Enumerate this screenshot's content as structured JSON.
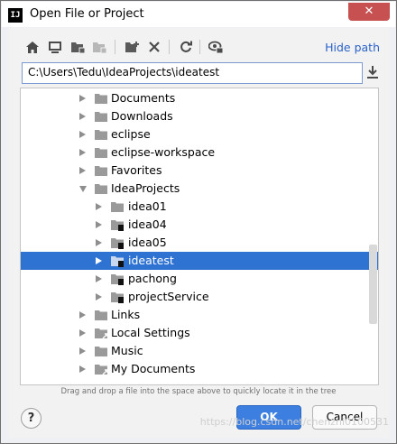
{
  "window": {
    "title": "Open File or Project",
    "logo": "IJ",
    "close": "✕"
  },
  "toolbar": {
    "icons": [
      "home-icon",
      "desktop-icon",
      "project-folder-icon",
      "module-folder-icon",
      "new-folder-icon",
      "delete-icon",
      "refresh-icon",
      "show-hidden-icon"
    ],
    "hide_path_label": "Hide path"
  },
  "path_field": {
    "value": "C:\\Users\\Tedu\\IdeaProjects\\ideatest"
  },
  "tree": {
    "items": [
      {
        "label": "Documents",
        "level": 0,
        "expanded": false,
        "icon": "folder-icon",
        "selected": false
      },
      {
        "label": "Downloads",
        "level": 0,
        "expanded": false,
        "icon": "folder-icon",
        "selected": false
      },
      {
        "label": "eclipse",
        "level": 0,
        "expanded": false,
        "icon": "folder-icon",
        "selected": false
      },
      {
        "label": "eclipse-workspace",
        "level": 0,
        "expanded": false,
        "icon": "folder-icon",
        "selected": false
      },
      {
        "label": "Favorites",
        "level": 0,
        "expanded": false,
        "icon": "folder-icon",
        "selected": false
      },
      {
        "label": "IdeaProjects",
        "level": 0,
        "expanded": true,
        "icon": "folder-icon",
        "selected": false
      },
      {
        "label": "idea01",
        "level": 1,
        "expanded": false,
        "icon": "folder-icon",
        "selected": false
      },
      {
        "label": "idea04",
        "level": 1,
        "expanded": false,
        "icon": "project-folder-icon",
        "selected": false
      },
      {
        "label": "idea05",
        "level": 1,
        "expanded": false,
        "icon": "project-folder-icon",
        "selected": false
      },
      {
        "label": "ideatest",
        "level": 1,
        "expanded": false,
        "icon": "project-folder-icon",
        "selected": true
      },
      {
        "label": "pachong",
        "level": 1,
        "expanded": false,
        "icon": "project-folder-icon",
        "selected": false
      },
      {
        "label": "projectService",
        "level": 1,
        "expanded": false,
        "icon": "project-folder-icon",
        "selected": false
      },
      {
        "label": "Links",
        "level": 0,
        "expanded": false,
        "icon": "folder-icon",
        "selected": false
      },
      {
        "label": "Local Settings",
        "level": 0,
        "expanded": false,
        "icon": "shortcut-folder-icon",
        "selected": false
      },
      {
        "label": "Music",
        "level": 0,
        "expanded": false,
        "icon": "folder-icon",
        "selected": false
      },
      {
        "label": "My Documents",
        "level": 0,
        "expanded": false,
        "icon": "shortcut-folder-icon",
        "selected": false
      }
    ]
  },
  "hint": "Drag and drop a file into the space above to quickly locate it in the tree",
  "buttons": {
    "ok": "OK",
    "cancel": "Cancel",
    "help": "?"
  },
  "watermark": "https://blog.csdn.net/chenzhi0100531",
  "colors": {
    "accent": "#2e72d2",
    "link": "#2a62c9",
    "close": "#c75050"
  }
}
